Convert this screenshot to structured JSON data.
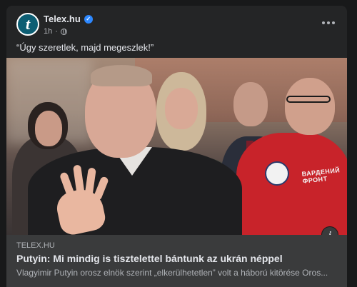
{
  "post": {
    "page_name": "Telex.hu",
    "avatar_letter": "t",
    "timestamp": "1h",
    "caption": "“Úgy szeretlek, majd megeszlek!”",
    "icons": {
      "verified": "verified-badge-icon",
      "audience": "globe-icon",
      "more": "more-options-icon",
      "info": "info-icon"
    }
  },
  "link_card": {
    "domain": "TELEX.HU",
    "title": "Putyin: Mi mindig is tisztelettel bántunk az ukrán néppel",
    "description": "Vlagyimir Putyin orosz elnök szerint „elkerülhetetlen” volt a háború kitörése Oros...",
    "image_text": "ВАРДЕНИЙ ФРОНТ",
    "info_glyph": "i"
  },
  "colors": {
    "background": "#18191a",
    "card": "#242526",
    "link_bar": "#3a3b3c",
    "verified": "#2d88ff",
    "avatar": "#0d5e73"
  }
}
